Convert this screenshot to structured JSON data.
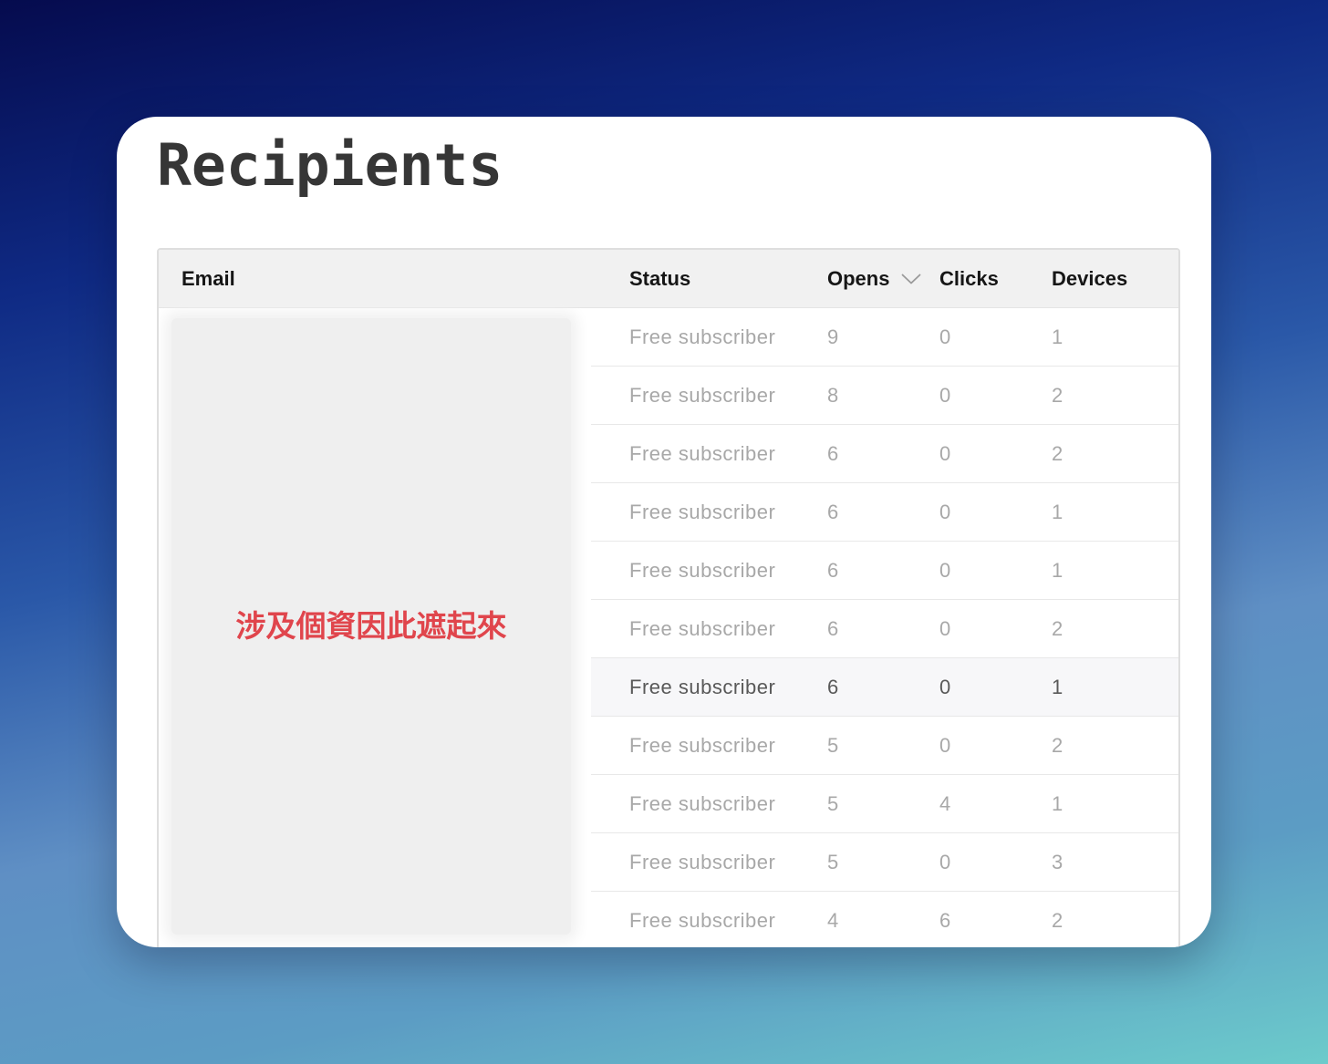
{
  "page": {
    "title": "Recipients"
  },
  "table": {
    "columns": {
      "email": "Email",
      "status": "Status",
      "opens": "Opens",
      "clicks": "Clicks",
      "devices": "Devices"
    },
    "sort": {
      "column": "Opens",
      "direction": "descending",
      "icon": "chevron-down-icon"
    },
    "redaction_note": "涉及個資因此遮起來",
    "rows": [
      {
        "status": "Free subscriber",
        "opens": "9",
        "clicks": "0",
        "devices": "1"
      },
      {
        "status": "Free subscriber",
        "opens": "8",
        "clicks": "0",
        "devices": "2"
      },
      {
        "status": "Free subscriber",
        "opens": "6",
        "clicks": "0",
        "devices": "2"
      },
      {
        "status": "Free subscriber",
        "opens": "6",
        "clicks": "0",
        "devices": "1"
      },
      {
        "status": "Free subscriber",
        "opens": "6",
        "clicks": "0",
        "devices": "1"
      },
      {
        "status": "Free subscriber",
        "opens": "6",
        "clicks": "0",
        "devices": "2"
      },
      {
        "status": "Free subscriber",
        "opens": "6",
        "clicks": "0",
        "devices": "1"
      },
      {
        "status": "Free subscriber",
        "opens": "5",
        "clicks": "0",
        "devices": "2"
      },
      {
        "status": "Free subscriber",
        "opens": "5",
        "clicks": "4",
        "devices": "1"
      },
      {
        "status": "Free subscriber",
        "opens": "5",
        "clicks": "0",
        "devices": "3"
      },
      {
        "status": "Free subscriber",
        "opens": "4",
        "clicks": "6",
        "devices": "2"
      }
    ]
  },
  "colors": {
    "note_red": "#e0454c",
    "title_text": "#363636",
    "muted_text": "#a8a8a8",
    "header_bg": "#f1f1f1"
  }
}
